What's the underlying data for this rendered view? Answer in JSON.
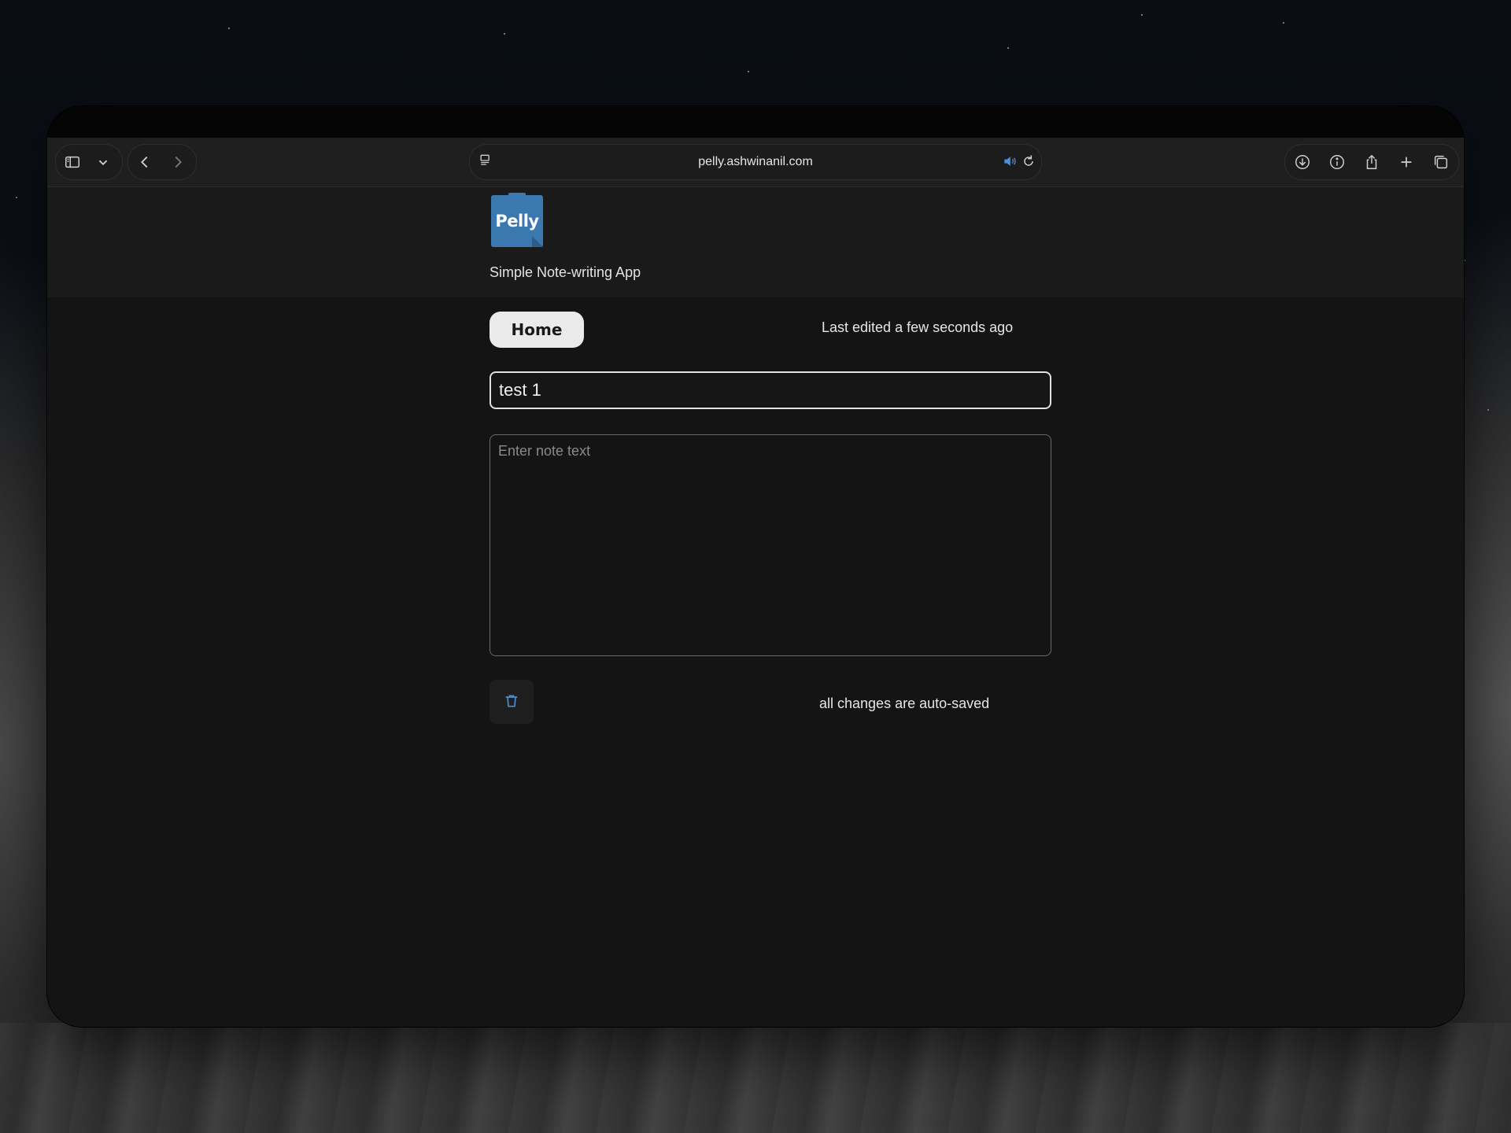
{
  "browser": {
    "url": "pelly.ashwinanil.com",
    "icons": {
      "sidebar": "sidebar-icon",
      "sidebar_menu": "chevron-down-icon",
      "back": "chevron-left-icon",
      "forward": "chevron-right-icon",
      "reader": "reader-icon",
      "audio": "speaker-icon",
      "reload": "reload-icon",
      "download": "download-icon",
      "info": "info-icon",
      "share": "share-icon",
      "new_tab": "plus-icon",
      "tabs": "tabs-overview-icon"
    },
    "audio_color": "#4a90d9"
  },
  "app": {
    "logo_text": "Pelly",
    "logo_color": "#3b78b0",
    "subtitle": "Simple Note-writing App"
  },
  "note": {
    "home_label": "Home",
    "last_edited": "Last edited a few seconds ago",
    "title_value": "test 1",
    "body_placeholder": "Enter note text",
    "body_value": "",
    "autosave_status": "all changes are auto-saved",
    "delete_icon": "trash-icon",
    "delete_icon_color": "#4a8fd0"
  }
}
